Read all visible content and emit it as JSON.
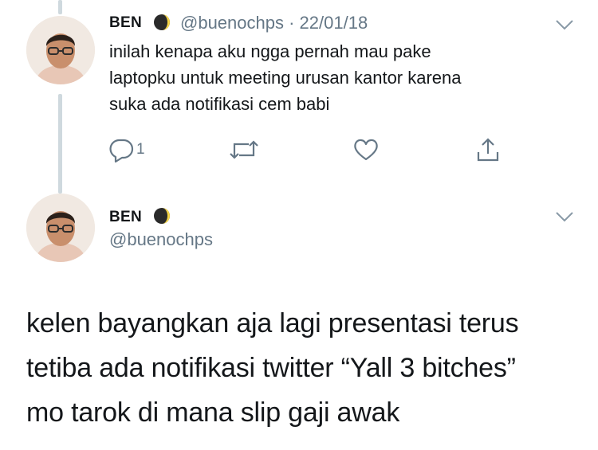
{
  "tweet1": {
    "display_name": "BEN",
    "handle": "@buenochps",
    "date": "22/01/18",
    "text_lines": [
      "inilah kenapa aku ngga pernah mau pake",
      "laptopku untuk meeting urusan kantor karena",
      "suka ada notifikasi cem babi"
    ],
    "reply_count": "1",
    "icons": [
      "verified-moon-icon",
      "chevron-down-icon",
      "reply-icon",
      "retweet-icon",
      "like-icon",
      "share-icon"
    ]
  },
  "tweet2": {
    "display_name": "BEN",
    "handle": "@buenochps",
    "text_lines": [
      "kelen bayangkan aja lagi presentasi terus",
      "tetiba ada notifikasi twitter “Yall 3 bitches”",
      "mo tarok di mana slip gaji awak"
    ],
    "icons": [
      "verified-moon-icon",
      "chevron-down-icon"
    ]
  },
  "colors": {
    "text": "#14171a",
    "secondary": "#657786",
    "thread_line": "#cfd9de",
    "moon_yellow": "#f5d547"
  }
}
